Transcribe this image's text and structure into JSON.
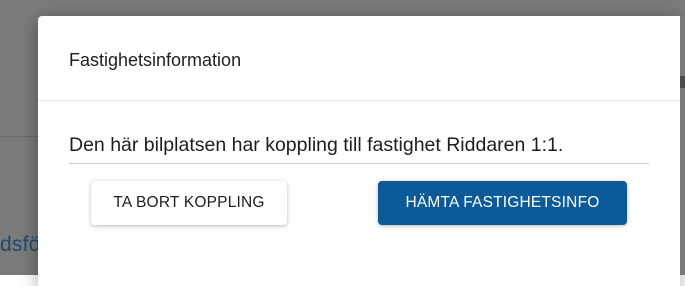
{
  "background": {
    "partial_text": "dsfö"
  },
  "dialog": {
    "title": "Fastighetsinformation",
    "message": "Den här bilplatsen har koppling till fastighet Riddaren 1:1.",
    "buttons": {
      "remove_label": "TA BORT KOPPLING",
      "fetch_label": "HÄMTA FASTIGHETSINFO"
    }
  },
  "colors": {
    "primary_button": "#0c5a98",
    "backdrop": "#7a7a7a"
  }
}
